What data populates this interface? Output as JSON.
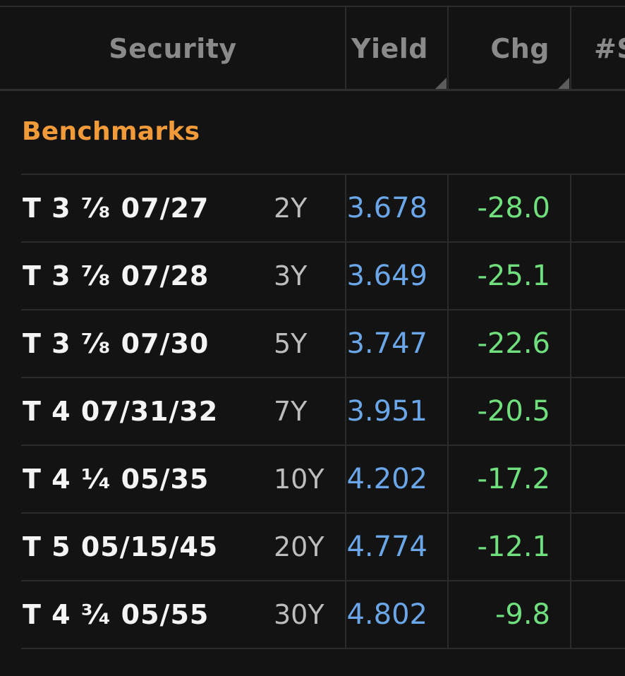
{
  "header": {
    "security": "Security",
    "yield": "Yield",
    "chg": "Chg",
    "spread": "#S"
  },
  "group": {
    "title": "Benchmarks"
  },
  "rows": [
    {
      "security": "T 3 ⁷⁄₈ 07/27",
      "tenor": "2Y",
      "yield": "3.678",
      "chg": "-28.0"
    },
    {
      "security": "T 3 ⁷⁄₈ 07/28",
      "tenor": "3Y",
      "yield": "3.649",
      "chg": "-25.1"
    },
    {
      "security": "T 3 ⁷⁄₈ 07/30",
      "tenor": "5Y",
      "yield": "3.747",
      "chg": "-22.6"
    },
    {
      "security": "T 4 07/31/32",
      "tenor": "7Y",
      "yield": "3.951",
      "chg": "-20.5"
    },
    {
      "security": "T 4 ¹⁄₄ 05/35",
      "tenor": "10Y",
      "yield": "4.202",
      "chg": "-17.2"
    },
    {
      "security": "T 5 05/15/45",
      "tenor": "20Y",
      "yield": "4.774",
      "chg": "-12.1"
    },
    {
      "security": "T 4 ³⁄₄ 05/55",
      "tenor": "30Y",
      "yield": "4.802",
      "chg": "-9.8"
    }
  ],
  "colors": {
    "background": "#131313",
    "group_title": "#f09a3a",
    "yield": "#6aa6e8",
    "chg_negative": "#6fe07d",
    "header_text": "#8a8a8a"
  }
}
